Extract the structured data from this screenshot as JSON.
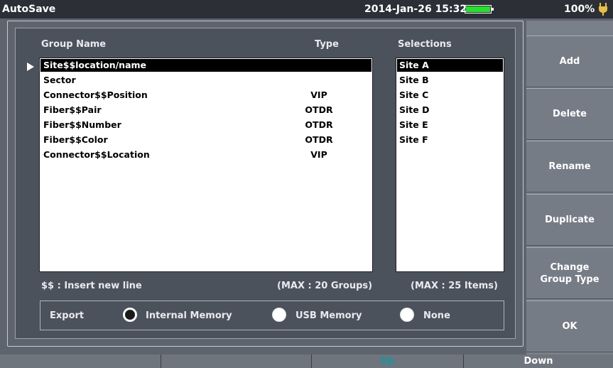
{
  "titlebar": {
    "app_title": "AutoSave",
    "datetime": "2014-Jan-26 15:32",
    "battery_level": 1.0,
    "battery_percent": "100%",
    "power_icon": "plug-icon",
    "battery_color": "#22e22a"
  },
  "groups": {
    "header_name": "Group Name",
    "header_type": "Type",
    "rows": [
      {
        "name": "Site$$location/name",
        "type": "",
        "selected": true
      },
      {
        "name": "Sector",
        "type": ""
      },
      {
        "name": "Connector$$Position",
        "type": "VIP"
      },
      {
        "name": "Fiber$$Pair",
        "type": "OTDR"
      },
      {
        "name": "Fiber$$Number",
        "type": "OTDR"
      },
      {
        "name": "Fiber$$Color",
        "type": "OTDR"
      },
      {
        "name": "Connector$$Location",
        "type": "VIP"
      }
    ],
    "note_insert": "$$ : Insert new line",
    "note_max": "(MAX : 20 Groups)"
  },
  "selections": {
    "header": "Selections",
    "items": [
      "Site A",
      "Site B",
      "Site C",
      "Site D",
      "Site E",
      "Site F"
    ],
    "selected_index": 0,
    "note_max": "(MAX : 25 Items)"
  },
  "export": {
    "label": "Export",
    "options": [
      {
        "label": "Internal Memory",
        "selected": true
      },
      {
        "label": "USB Memory",
        "selected": false
      },
      {
        "label": "None",
        "selected": false
      }
    ]
  },
  "softkeys": {
    "add": "Add",
    "delete": "Delete",
    "rename": "Rename",
    "duplicate": "Duplicate",
    "change_line1": "Change",
    "change_line2": "Group Type",
    "ok": "OK"
  },
  "bottombar": {
    "keys": [
      "",
      "",
      "Up",
      "Down"
    ],
    "up_color": "#0e9aa0"
  }
}
